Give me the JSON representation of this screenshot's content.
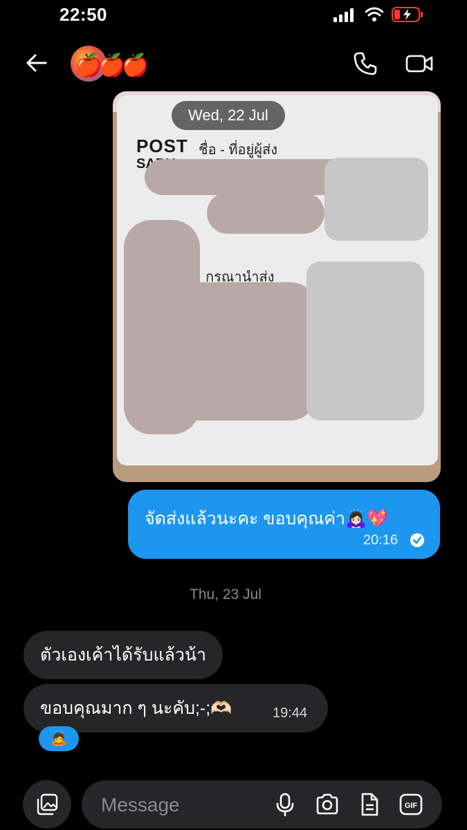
{
  "status_bar": {
    "time": "22:50"
  },
  "header": {
    "contact_emoji": "🍎🍎🍎"
  },
  "photo": {
    "post_text": "POST",
    "sabuy_text": "SABU",
    "sender_label": "ชื่อ - ที่อยู่ผู้ส่ง",
    "deliver_label": "กรุณานำส่ง"
  },
  "date_chip": "Wed, 22 Jul",
  "sent_message": {
    "text": "จัดส่งแล้วนะคะ ขอบคุณค่า🙇🏻‍♀️💖",
    "time": "20:16"
  },
  "day_separator": "Thu, 23 Jul",
  "received_messages": [
    {
      "text": "ตัวเองเค้าได้รับแล้วน้า"
    },
    {
      "text": "ขอบคุณมาก ๆ นะคับ;-;🫶🏻",
      "time": "19:44"
    }
  ],
  "reaction": "🙇",
  "composer": {
    "placeholder": "Message"
  },
  "colors": {
    "accent": "#1d96f0",
    "bubble_received": "#262629",
    "background": "#000000"
  }
}
